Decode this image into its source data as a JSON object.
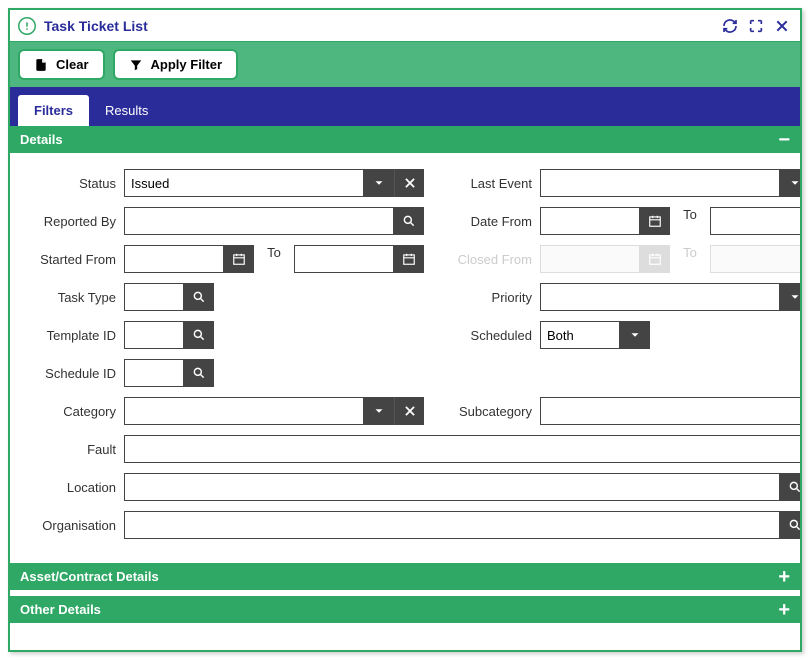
{
  "window": {
    "title": "Task Ticket List"
  },
  "toolbar": {
    "clear": "Clear",
    "apply": "Apply Filter"
  },
  "tabs": {
    "filters": "Filters",
    "results": "Results"
  },
  "sections": {
    "details": "Details",
    "assetcontract": "Asset/Contract Details",
    "other": "Other Details"
  },
  "labels": {
    "status": "Status",
    "lastevent": "Last Event",
    "reportedby": "Reported By",
    "datefrom": "Date From",
    "to": "To",
    "startedfrom": "Started From",
    "closedfrom": "Closed From",
    "tasktype": "Task Type",
    "priority": "Priority",
    "templateid": "Template ID",
    "scheduled": "Scheduled",
    "scheduleid": "Schedule ID",
    "category": "Category",
    "subcategory": "Subcategory",
    "fault": "Fault",
    "location": "Location",
    "organisation": "Organisation"
  },
  "values": {
    "status": "Issued",
    "scheduled": "Both"
  }
}
